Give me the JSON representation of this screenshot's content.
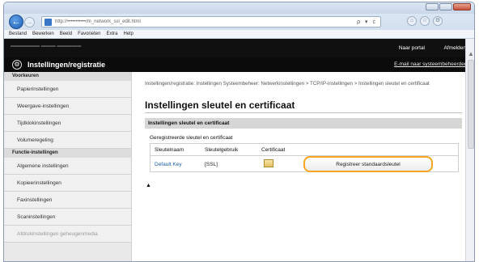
{
  "browser": {
    "address": "http://•••••••••••/m_network_ssl_edit.html",
    "address_controls": "ρ ▾ ċ",
    "menu": [
      "Bestand",
      "Bewerken",
      "Beeld",
      "Favorieten",
      "Extra",
      "Help"
    ]
  },
  "header": {
    "portal_link": "Naar portal",
    "logout_link": "Afmelden",
    "app_title": "Instellingen/registratie",
    "email_link": "E-mail naar systeembeheerder"
  },
  "sidebar": {
    "section1": "Voorkeuren",
    "items1": [
      "Papierinstellingen",
      "Weergave-instellingen",
      "Tijdklokinstellingen",
      "Volumeregeling"
    ],
    "section2": "Functie-instellingen",
    "items2": [
      "Algemene instellingen",
      "Kopieerinstellingen",
      "Faxinstellingen",
      "Scaninstellingen",
      "Afdrukinstellingen geheugenmedia"
    ]
  },
  "main": {
    "breadcrumb": "Instellingen/registratie: Instellingen Systeembeheer: Netwerkinstellingen > TCP/IP-instellingen > Instellingen sleutel en certificaat",
    "title": "Instellingen sleutel en certificaat",
    "section_header": "Instellingen sleutel en certificaat",
    "registered_label": "Geregistreerde sleutel en certificaat",
    "columns": [
      "Sleutelnaam",
      "Sleutelgebruik",
      "Certificaat"
    ],
    "row": {
      "key_name": "Default Key",
      "usage": "[SSL]"
    },
    "register_button": "Registreer standaardsleutel",
    "top_arrow": "▲"
  }
}
